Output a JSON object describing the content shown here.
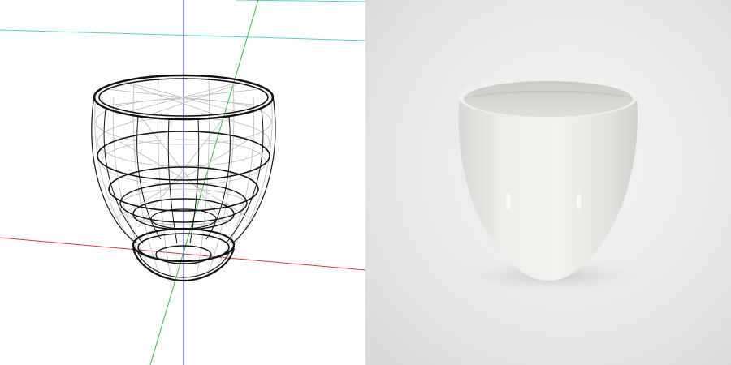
{
  "colors": {
    "viewport_bg": "#ffffff",
    "axis_x": "#d23a3a",
    "axis_y": "#2fbf3b",
    "axis_z": "#3b3bc8",
    "grid_line": "#5ccfcf",
    "wire_dark": "#111111",
    "wire_light": "#b9b9b9",
    "render_bg": "#e6e6e6",
    "cup_body": "#e9eae6",
    "cup_shadow": "#cfd1cc",
    "cup_inner": "#d8d9d6"
  },
  "panels": {
    "left": {
      "view": "wireframe"
    },
    "right": {
      "view": "render"
    }
  }
}
